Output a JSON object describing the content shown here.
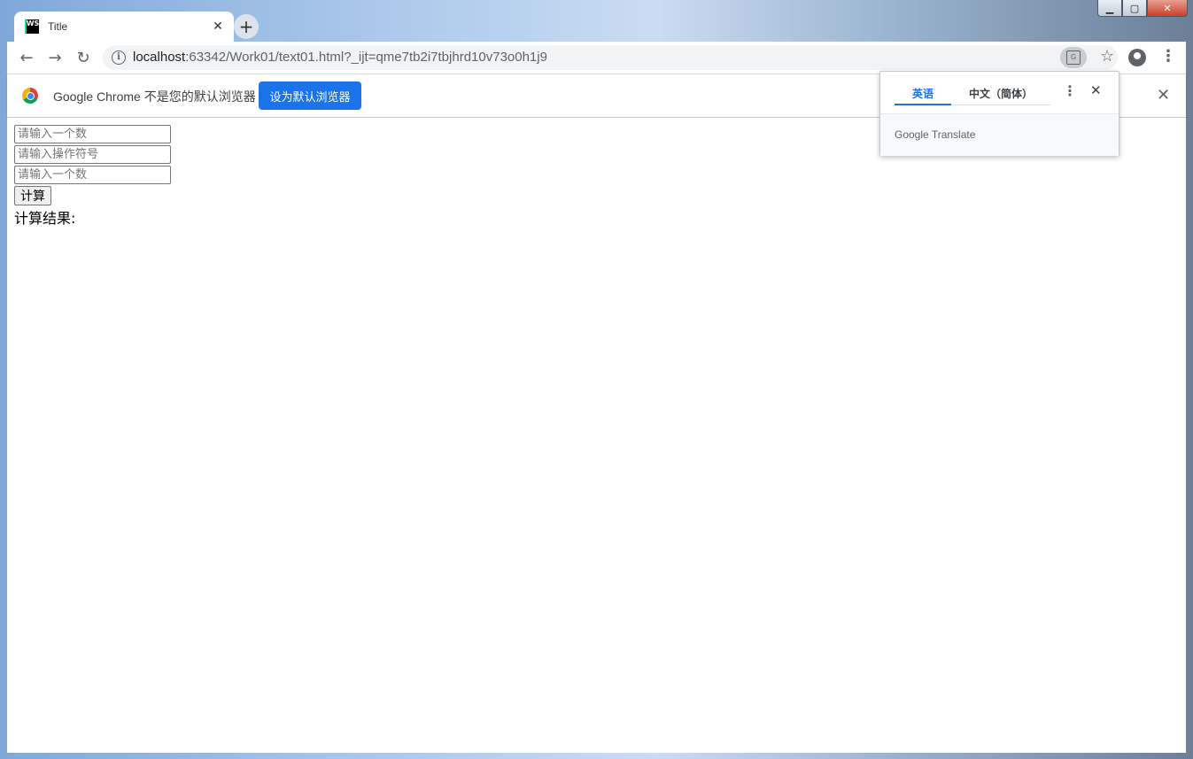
{
  "window": {
    "minimize_label": "▁",
    "maximize_label": "▢",
    "close_label": "✕"
  },
  "tab": {
    "favicon_text": "WS",
    "title": "Title",
    "close_label": "✕"
  },
  "new_tab_label": "+",
  "toolbar": {
    "back_label": "←",
    "forward_label": "→",
    "reload_label": "↻",
    "url_host": "localhost",
    "url_rest": ":63342/Work01/text01.html?_ijt=qme7tb2i7tbjhrd10v73o0h1j9",
    "star_label": "☆",
    "menu_label": "⋮",
    "translate_glyph": "G"
  },
  "infobar": {
    "message": "Google Chrome 不是您的默认浏览器",
    "set_default_label": "设为默认浏览器",
    "close_label": "✕"
  },
  "form": {
    "first_number_placeholder": "请输入一个数",
    "operator_placeholder": "请输入操作符号",
    "second_number_placeholder": "请输入一个数",
    "calculate_label": "计算",
    "result_label": "计算结果:"
  },
  "translate_popup": {
    "source_language": "英语",
    "target_language": "中文（简体）",
    "more_label": "⋮",
    "close_label": "✕",
    "brand_google": "Google",
    "brand_translate": "Translate"
  }
}
